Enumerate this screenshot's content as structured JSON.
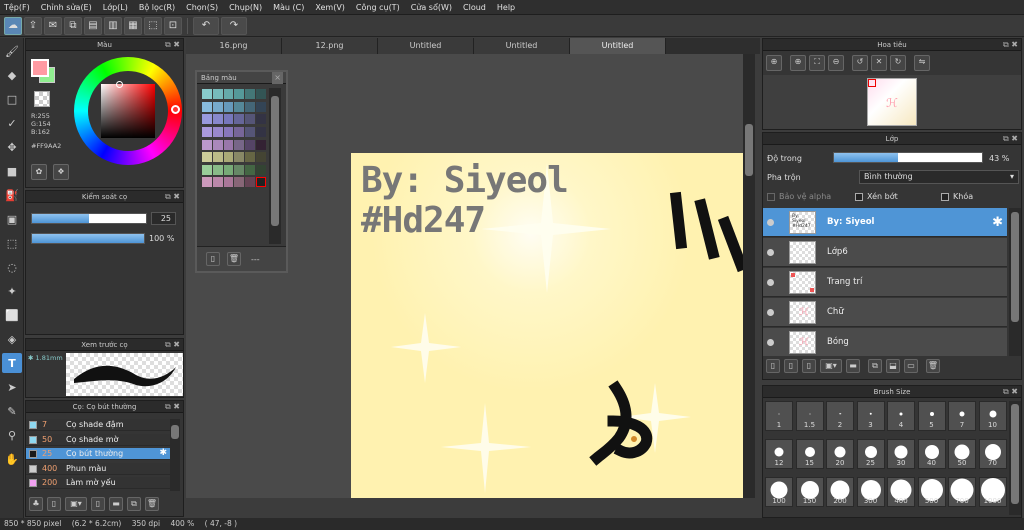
{
  "menu": [
    "Tệp(F)",
    "Chỉnh sửa(E)",
    "Lớp(L)",
    "Bộ lọc(R)",
    "Chọn(S)",
    "Chụp(N)",
    "Màu (C)",
    "Xem(V)",
    "Công cụ(T)",
    "Cửa sổ(W)",
    "Cloud",
    "Help"
  ],
  "color_panel": {
    "title": "Màu",
    "r": "R:255",
    "g": "G:154",
    "b": "B:162",
    "hex": "#FF9AA2"
  },
  "brush_control": {
    "title": "Kiểm soát cọ",
    "size": "25",
    "opacity": "100 %",
    "size_frac": 0.5,
    "opacity_frac": 1.0
  },
  "brush_preview": {
    "title": "Xem trước cọ",
    "size": "1.81mm"
  },
  "brush_list": {
    "title": "Cọ: Cọ bút thường",
    "items": [
      {
        "num": "7",
        "name": "Cọ shade đậm",
        "swatch": "#8fd8f0"
      },
      {
        "num": "50",
        "name": "Cọ shade mờ",
        "swatch": "#8fd8f0"
      },
      {
        "num": "25",
        "name": "Cọ bút thường",
        "swatch": "#1a1a1a",
        "selected": true
      },
      {
        "num": "400",
        "name": "Phun màu",
        "swatch": "#cccccc"
      },
      {
        "num": "200",
        "name": "Làm mờ yếu",
        "swatch": "#f0a0f0"
      }
    ]
  },
  "tabs": [
    "16.png",
    "12.png",
    "Untitled",
    "Untitled",
    "Untitled"
  ],
  "palette": {
    "title": "Bảng màu",
    "footer": "---"
  },
  "navigator": {
    "title": "Hoa tiêu"
  },
  "layers": {
    "title": "Lớp",
    "opacity_label": "Độ trong",
    "opacity": "43 %",
    "opacity_frac": 0.43,
    "blend_label": "Pha trộn",
    "blend": "Bình thường",
    "protect_alpha": "Bảo vệ alpha",
    "clipping": "Xén bớt",
    "lock": "Khóa",
    "items": [
      {
        "name": "By: Siyeol",
        "selected": true,
        "thumb_text": "By: Siyeol\n#Hd247"
      },
      {
        "name": "Lớp6"
      },
      {
        "name": "Trang trí"
      },
      {
        "name": "Chữ"
      },
      {
        "name": "Bóng"
      }
    ]
  },
  "brush_size": {
    "title": "Brush Size",
    "sizes": [
      "1",
      "1.5",
      "2",
      "3",
      "4",
      "5",
      "7",
      "10",
      "12",
      "15",
      "20",
      "25",
      "30",
      "40",
      "50",
      "70",
      "100",
      "150",
      "200",
      "300",
      "400",
      "500",
      "700",
      "1000"
    ]
  },
  "canvas_text": {
    "line1": "By: Siyeol",
    "line2": "#Hd247"
  },
  "status": {
    "size": "850 * 850 pixel",
    "cm": "(6.2 * 6.2cm)",
    "dpi": "350 dpi",
    "zoom": "400 %",
    "coords": "( 47, -8 )"
  },
  "colors": {
    "accent": "#4f95d6",
    "current": "#FF9AA2",
    "secondary": "#90EE90"
  }
}
